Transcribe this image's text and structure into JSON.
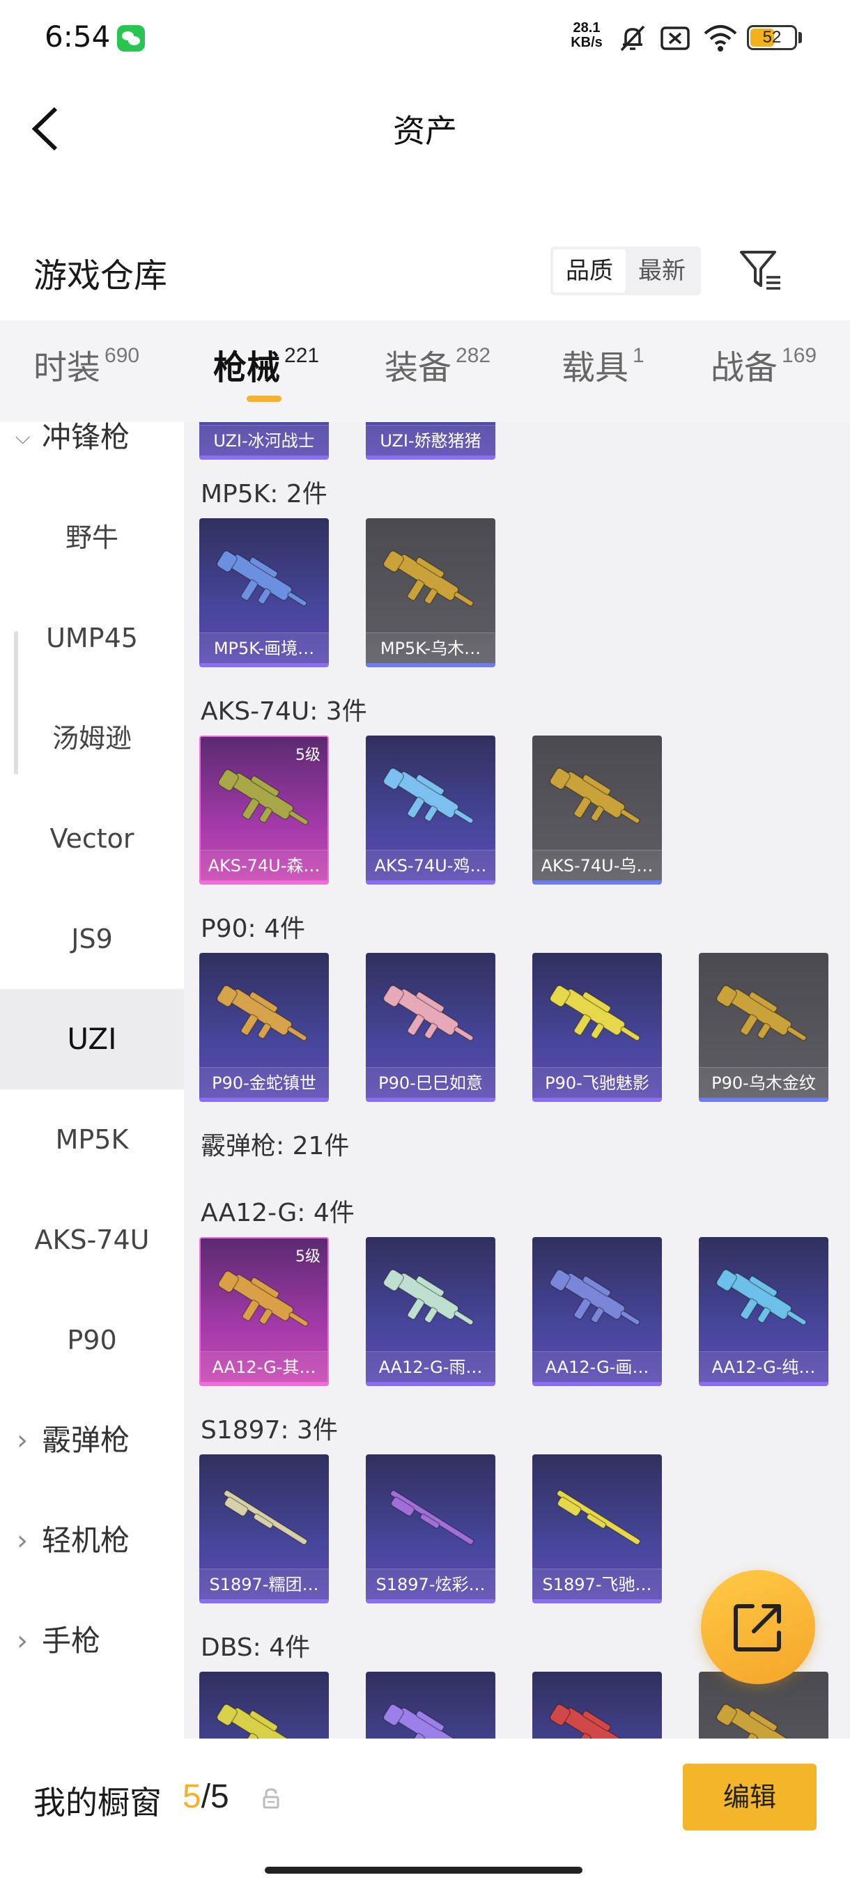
{
  "status_bar": {
    "time": "6:54",
    "net_speed_value": "28.1",
    "net_speed_unit": "KB/s",
    "battery": "52",
    "battery_level": 0.52,
    "icons": [
      "wechat-icon",
      "mute-icon",
      "no-sim-icon",
      "wifi-icon",
      "battery-icon"
    ]
  },
  "nav": {
    "title": "资产",
    "back_icon": "chevron-left-icon"
  },
  "warehouse": {
    "title": "游戏仓库",
    "sort_options": [
      "品质",
      "最新"
    ],
    "active_sort": "品质",
    "filter_icon": "filter-list-icon"
  },
  "tabs": [
    {
      "label": "时装",
      "count": "690"
    },
    {
      "label": "枪械",
      "count": "221",
      "active": true
    },
    {
      "label": "装备",
      "count": "282"
    },
    {
      "label": "载具",
      "count": "1"
    },
    {
      "label": "战备",
      "count": "169"
    }
  ],
  "sidebar": [
    {
      "label": "冲锋枪",
      "type": "group",
      "expanded": true
    },
    {
      "label": "野牛"
    },
    {
      "label": "UMP45"
    },
    {
      "label": "汤姆逊"
    },
    {
      "label": "Vector"
    },
    {
      "label": "JS9"
    },
    {
      "label": "UZI",
      "active": true
    },
    {
      "label": "MP5K"
    },
    {
      "label": "AKS-74U"
    },
    {
      "label": "P90"
    },
    {
      "label": "霰弹枪",
      "type": "group"
    },
    {
      "label": "轻机枪",
      "type": "group"
    },
    {
      "label": "手枪",
      "type": "group"
    }
  ],
  "content": {
    "top_partial_cards": [
      "UZI-冰河战士",
      "UZI-娇憨猪猪"
    ],
    "sections": [
      {
        "title": "MP5K: 2件",
        "items": [
          {
            "name": "MP5K-画境…",
            "rarity": "purple",
            "gun_color": "#6c8fe0"
          },
          {
            "name": "MP5K-乌木…",
            "rarity": "gray",
            "gun_color": "#c9a23a"
          }
        ]
      },
      {
        "title": "AKS-74U: 3件",
        "items": [
          {
            "name": "AKS-74U-森…",
            "rarity": "pink",
            "level": "5级",
            "gun_color": "#a8a848"
          },
          {
            "name": "AKS-74U-鸡…",
            "rarity": "purple",
            "gun_color": "#7cc0f0"
          },
          {
            "name": "AKS-74U-乌…",
            "rarity": "gray",
            "gun_color": "#c9a23a"
          }
        ]
      },
      {
        "title": "P90: 4件",
        "items": [
          {
            "name": "P90-金蛇镇世",
            "rarity": "purple",
            "gun_color": "#d6a24a"
          },
          {
            "name": "P90-巳巳如意",
            "rarity": "purple",
            "gun_color": "#e7a9b8"
          },
          {
            "name": "P90-飞驰魅影",
            "rarity": "purple",
            "gun_color": "#e6d84a"
          },
          {
            "name": "P90-乌木金纹",
            "rarity": "gray",
            "gun_color": "#c9a23a"
          }
        ]
      },
      {
        "title": "霰弹枪: 21件",
        "items": []
      },
      {
        "title": "AA12-G: 4件",
        "items": [
          {
            "name": "AA12-G-其…",
            "rarity": "pink",
            "level": "5级",
            "gun_color": "#d9a048"
          },
          {
            "name": "AA12-G-雨…",
            "rarity": "purple",
            "gun_color": "#bfe0d0"
          },
          {
            "name": "AA12-G-画…",
            "rarity": "purple",
            "gun_color": "#7a86d8"
          },
          {
            "name": "AA12-G-纯…",
            "rarity": "purple",
            "gun_color": "#6cc0ea"
          }
        ]
      },
      {
        "title": "S1897: 3件",
        "items": [
          {
            "name": "S1897-糯团…",
            "rarity": "purple",
            "gun_color": "#d8d0a8"
          },
          {
            "name": "S1897-炫彩…",
            "rarity": "purple",
            "gun_color": "#a070d8"
          },
          {
            "name": "S1897-飞驰…",
            "rarity": "purple",
            "gun_color": "#e6d84a"
          }
        ]
      },
      {
        "title": "DBS: 4件",
        "items": [
          {
            "name": "",
            "rarity": "purple",
            "gun_color": "#d8d048"
          },
          {
            "name": "",
            "rarity": "purple",
            "gun_color": "#9a80e8"
          },
          {
            "name": "",
            "rarity": "purple",
            "gun_color": "#d04848"
          },
          {
            "name": "",
            "rarity": "gray",
            "gun_color": "#c9a23a"
          }
        ]
      }
    ]
  },
  "fab": {
    "icon": "share-external-icon"
  },
  "bottom_bar": {
    "label": "我的橱窗",
    "current": "5",
    "separator": "/",
    "total": "5",
    "lock_icon": "lock-icon",
    "edit_label": "编辑"
  },
  "colors": {
    "accent": "#f5b22a",
    "purple_card": "#47469b",
    "pink_card": "#a23aa8",
    "gray_card": "#5e5e64"
  }
}
